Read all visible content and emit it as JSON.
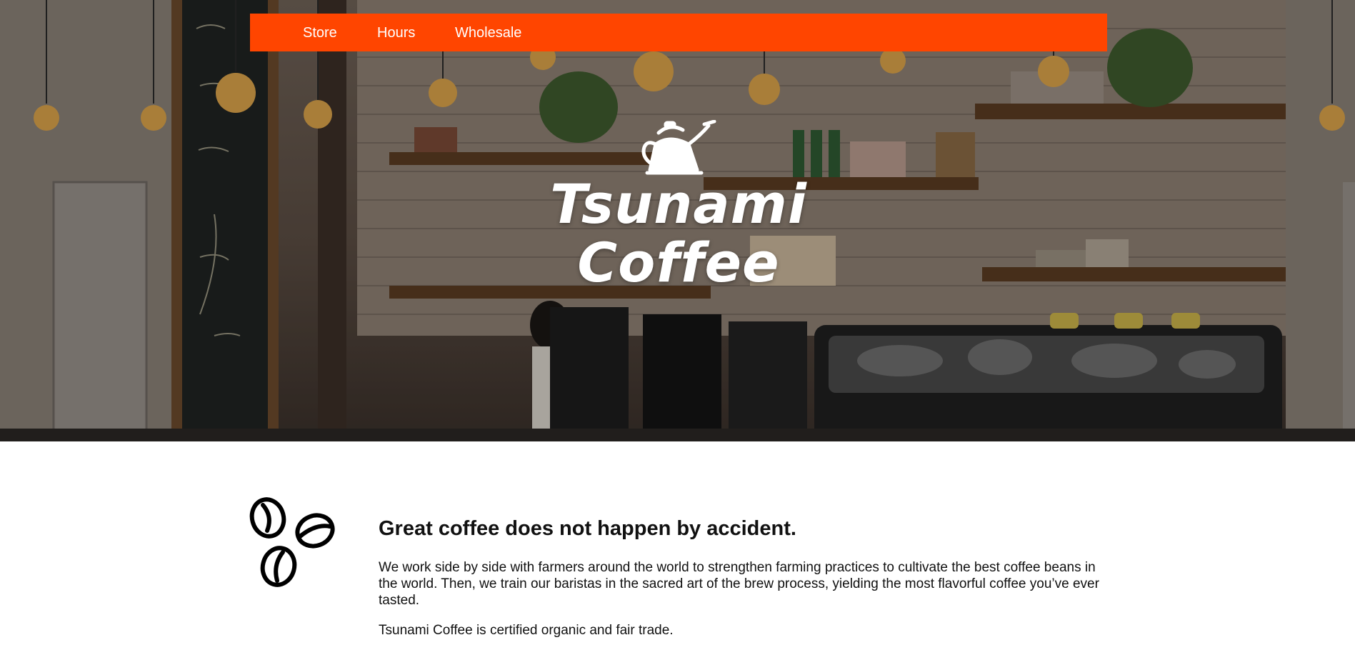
{
  "nav": {
    "items": [
      {
        "label": "Store"
      },
      {
        "label": "Hours"
      },
      {
        "label": "Wholesale"
      }
    ]
  },
  "hero": {
    "brand_line_1": "Tsunami",
    "brand_line_2": "Coffee",
    "logo_icon": "kettle-icon"
  },
  "intro": {
    "icon": "coffee-beans-icon",
    "headline": "Great coffee does not happen by accident.",
    "paragraph_1": "We work side by side with farmers around the world to strengthen farming practices to cultivate the best coffee beans in the world. Then, we train our baristas in the sacred art of the brew process, yielding the most flavorful coffee you’ve ever tasted.",
    "paragraph_2": "Tsunami Coffee is certified organic and fair trade."
  },
  "colors": {
    "nav_background": "#ff4500",
    "text": "#111111",
    "page_background": "#ffffff"
  }
}
